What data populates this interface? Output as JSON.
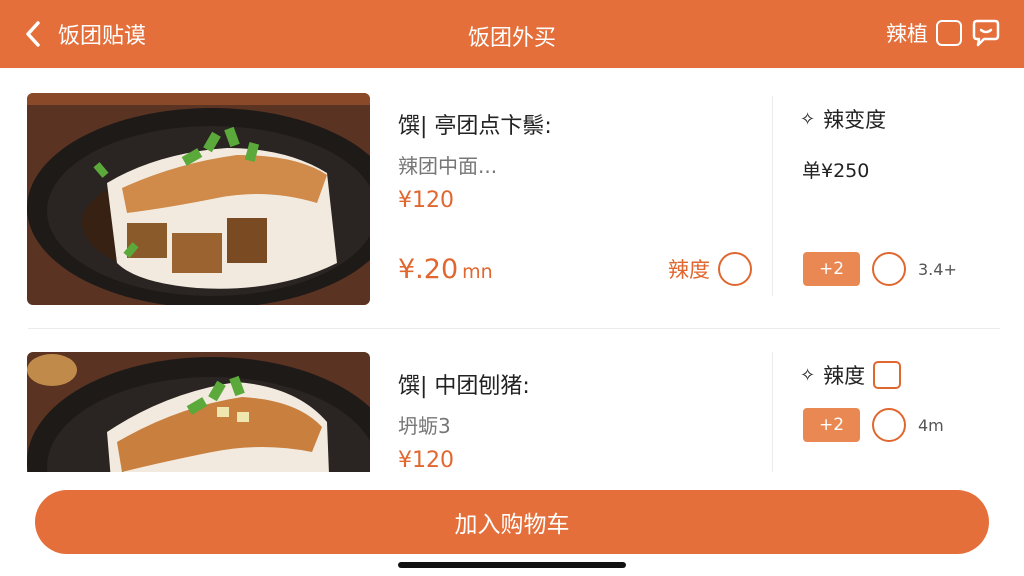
{
  "header": {
    "back_label": "饭团贴谟",
    "title": "饭团外买",
    "right_label": "辣植"
  },
  "items": [
    {
      "name": "馔| 亭团点卞鬃:",
      "desc": "辣团中面...",
      "price": "¥120",
      "big_price": "¥.20",
      "big_price_unit": "mn",
      "spice_label": "辣度",
      "right_title": "辣变度",
      "right_price": "单¥250",
      "badge": "+2",
      "small_text": "3.4+"
    },
    {
      "name": "馔| 中团刨猪:",
      "desc": "坍蛎3",
      "price": "¥120",
      "right_title": "辣度",
      "badge": "+2",
      "small_text": "4m"
    }
  ],
  "bottom": {
    "cart_label": "加入购物车"
  },
  "colors": {
    "accent": "#e46f3a",
    "price": "#e0672f",
    "badge": "#e98852"
  },
  "icons": [
    "chevron-left-icon",
    "checkbox-icon",
    "chat-bubble-icon",
    "sparkle-icon"
  ]
}
